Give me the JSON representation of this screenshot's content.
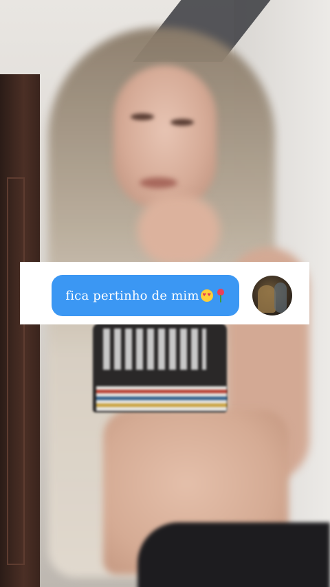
{
  "video": {
    "scene": "blurred-dance-video-frame"
  },
  "reply_sticker": {
    "comment_text": "fica pertinho de mim",
    "emojis": [
      "smiling-cat-heart-eyes",
      "rose"
    ],
    "bubble_color": "#3b97f3",
    "text_color": "#ffffff",
    "card_color": "#ffffff",
    "avatar": "commenter-avatar"
  }
}
